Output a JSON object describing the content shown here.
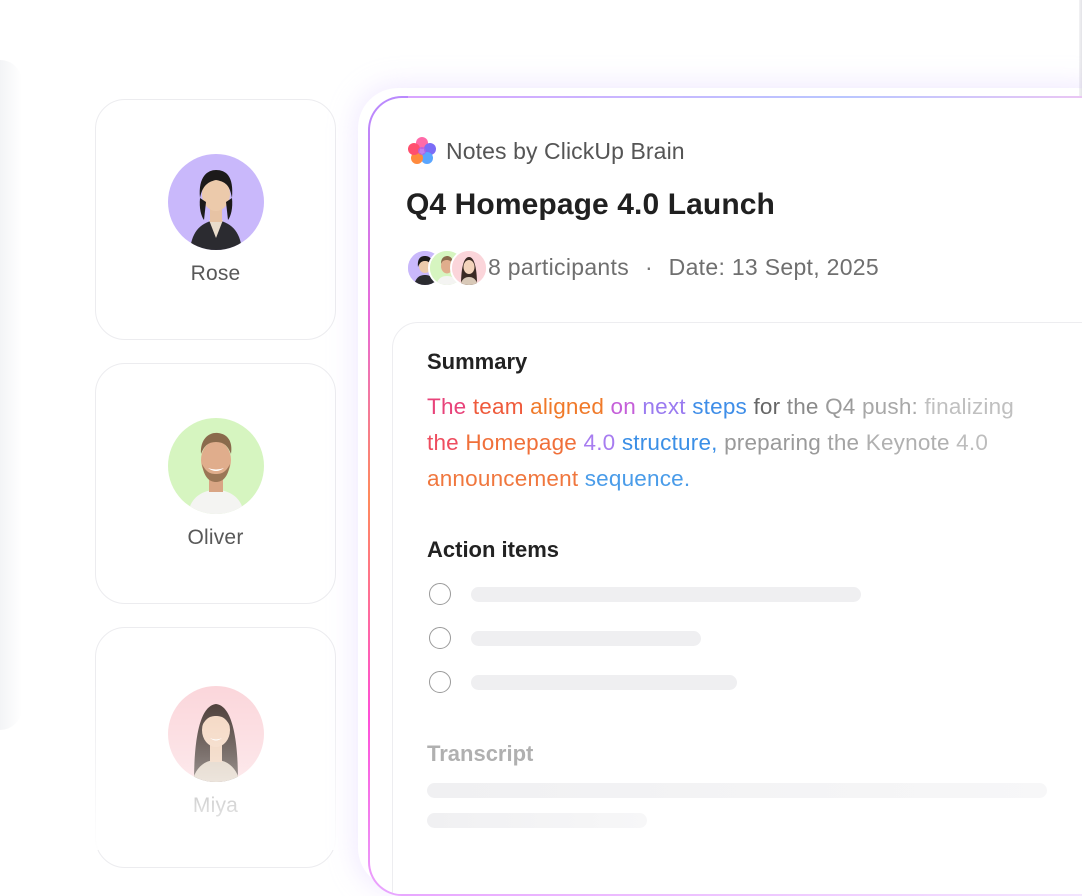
{
  "participants": [
    {
      "name": "Rose",
      "avatar_bg": "#c9b8fb",
      "icon": "person-avatar"
    },
    {
      "name": "Oliver",
      "avatar_bg": "#d6f5c0",
      "icon": "person-avatar"
    },
    {
      "name": "Miya",
      "avatar_bg": "#fbd5da",
      "icon": "person-avatar"
    }
  ],
  "notes": {
    "brand_label": "Notes by ClickUp Brain",
    "brand_icon": "clickup-brain-icon",
    "title": "Q4 Homepage 4.0 Launch",
    "participants_count": "8 participants",
    "separator": "·",
    "date": "Date: 13 Sept, 2025",
    "summary_heading": "Summary",
    "summary_words": [
      [
        "The",
        "team",
        "aligned",
        "on",
        "next",
        "steps",
        "for",
        "the",
        "Q4",
        "push:",
        "finalizing"
      ],
      [
        "the",
        "Homepage",
        "4.0",
        "structure,",
        "preparing",
        "the",
        "Keynote",
        "4.0"
      ],
      [
        "announcement",
        "sequence."
      ]
    ],
    "summary_colors": [
      [
        "#e8437a",
        "#ef5b3c",
        "#f07a2a",
        "#c55fd9",
        "#9a7bf0",
        "#3f8ee8",
        "#666666",
        "#8a8a8a",
        "#9b9b9b",
        "#a8a8a8",
        "#c0c0c0"
      ],
      [
        "#ee4d5f",
        "#f0703a",
        "#a77cf0",
        "#3b8fe6",
        "#9a9a9a",
        "#a4a4a4",
        "#b0b0b0",
        "#bdbdbd"
      ],
      [
        "#f0773e",
        "#4a9ce9"
      ]
    ],
    "action_heading": "Action items",
    "action_items": [
      {
        "done": false
      },
      {
        "done": false
      },
      {
        "done": false
      }
    ],
    "transcript_heading": "Transcript",
    "accent_colors": [
      "#b88bff",
      "#e86ad8",
      "#ff8a5c",
      "#ff4fd8"
    ]
  }
}
